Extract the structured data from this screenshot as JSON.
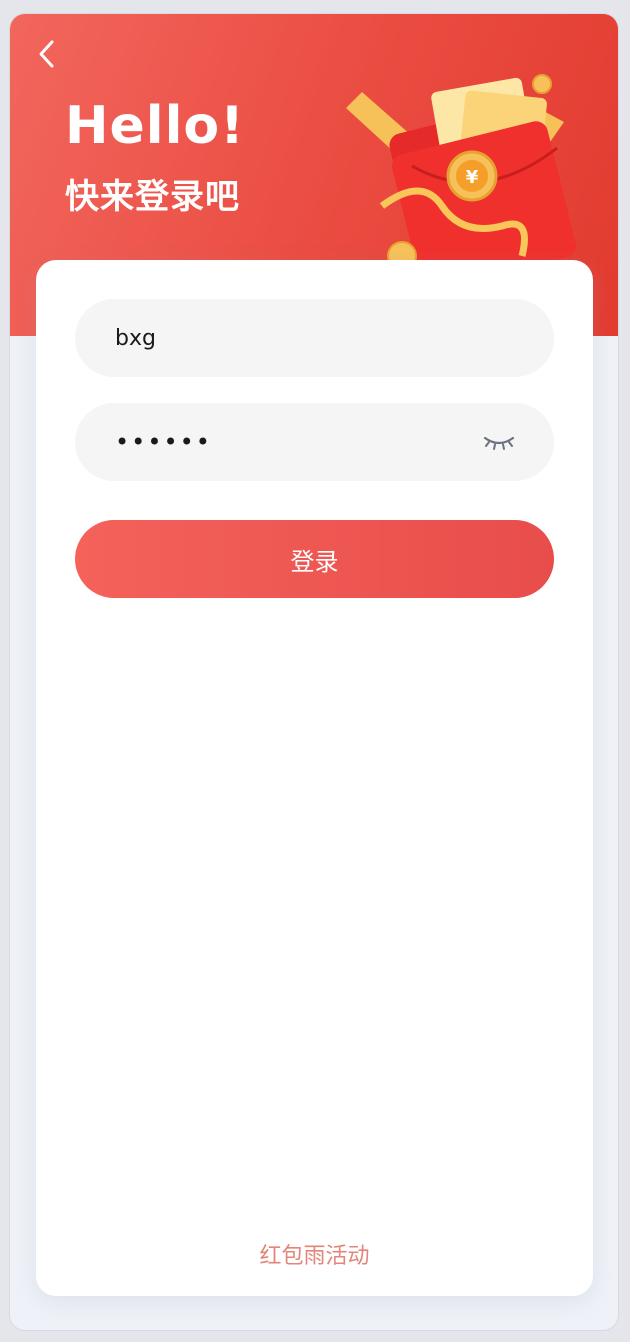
{
  "header": {
    "hello": "Hello!",
    "subtitle": "快来登录吧"
  },
  "form": {
    "username_value": "bxg",
    "password_value": "••••••",
    "login_label": "登录"
  },
  "footer": {
    "link_label": "红包雨活动"
  },
  "colors": {
    "header_start": "#f2665d",
    "header_end": "#e23b30",
    "button": "#f0574f",
    "link": "#e2857a"
  },
  "icons": {
    "back": "chevron-left-icon",
    "password_toggle": "closed-eye-icon",
    "illustration": "red-envelope-illustration"
  }
}
